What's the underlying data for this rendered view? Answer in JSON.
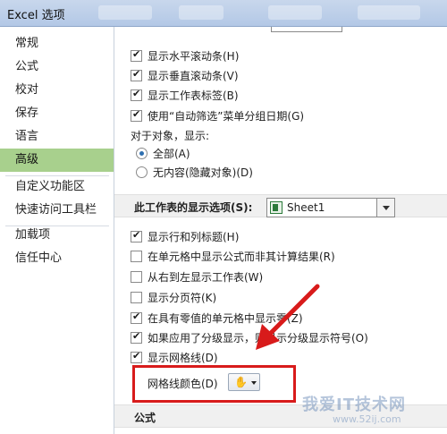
{
  "window": {
    "title": "Excel 选项"
  },
  "nav": {
    "items": [
      {
        "label": "常规"
      },
      {
        "label": "公式"
      },
      {
        "label": "校对"
      },
      {
        "label": "保存"
      },
      {
        "label": "语言"
      },
      {
        "label": "高级",
        "selected": true
      },
      {
        "label": "自定义功能区"
      },
      {
        "label": "快速访问工具栏"
      },
      {
        "label": "加载项"
      },
      {
        "label": "信任中心"
      }
    ]
  },
  "workbook_options": {
    "show_h_scroll": {
      "label": "显示水平滚动条(H)",
      "checked": true
    },
    "show_v_scroll": {
      "label": "显示垂直滚动条(V)",
      "checked": true
    },
    "show_sheet_tabs": {
      "label": "显示工作表标签(B)",
      "checked": true
    },
    "group_dates": {
      "label": "使用“自动筛选”菜单分组日期(G)",
      "checked": true
    },
    "objects_label": "对于对象，显示:",
    "objects_all": {
      "label": "全部(A)",
      "checked": true
    },
    "objects_none": {
      "label": "无内容(隐藏对象)(D)",
      "checked": false
    }
  },
  "sheet_section": {
    "header": "此工作表的显示选项(S):",
    "sheet_value": "Sheet1",
    "show_headers": {
      "label": "显示行和列标题(H)",
      "checked": true
    },
    "show_formulas": {
      "label": "在单元格中显示公式而非其计算结果(R)",
      "checked": false
    },
    "right_to_left": {
      "label": "从右到左显示工作表(W)",
      "checked": false
    },
    "show_page_breaks": {
      "label": "显示分页符(K)",
      "checked": false
    },
    "show_zero": {
      "label": "在具有零值的单元格中显示零(Z)",
      "checked": true
    },
    "show_outline": {
      "label": "如果应用了分级显示，则显示分级显示符号(O)",
      "checked": true
    },
    "show_gridlines": {
      "label": "显示网格线(D)",
      "checked": true
    },
    "gridline_color_label": "网格线颜色(D)"
  },
  "formula_section": {
    "header": "公式"
  },
  "annotation": {
    "color": "#d81b1b"
  },
  "watermark": {
    "text": "我爱IT技术网",
    "url": "www.52ij.com"
  }
}
